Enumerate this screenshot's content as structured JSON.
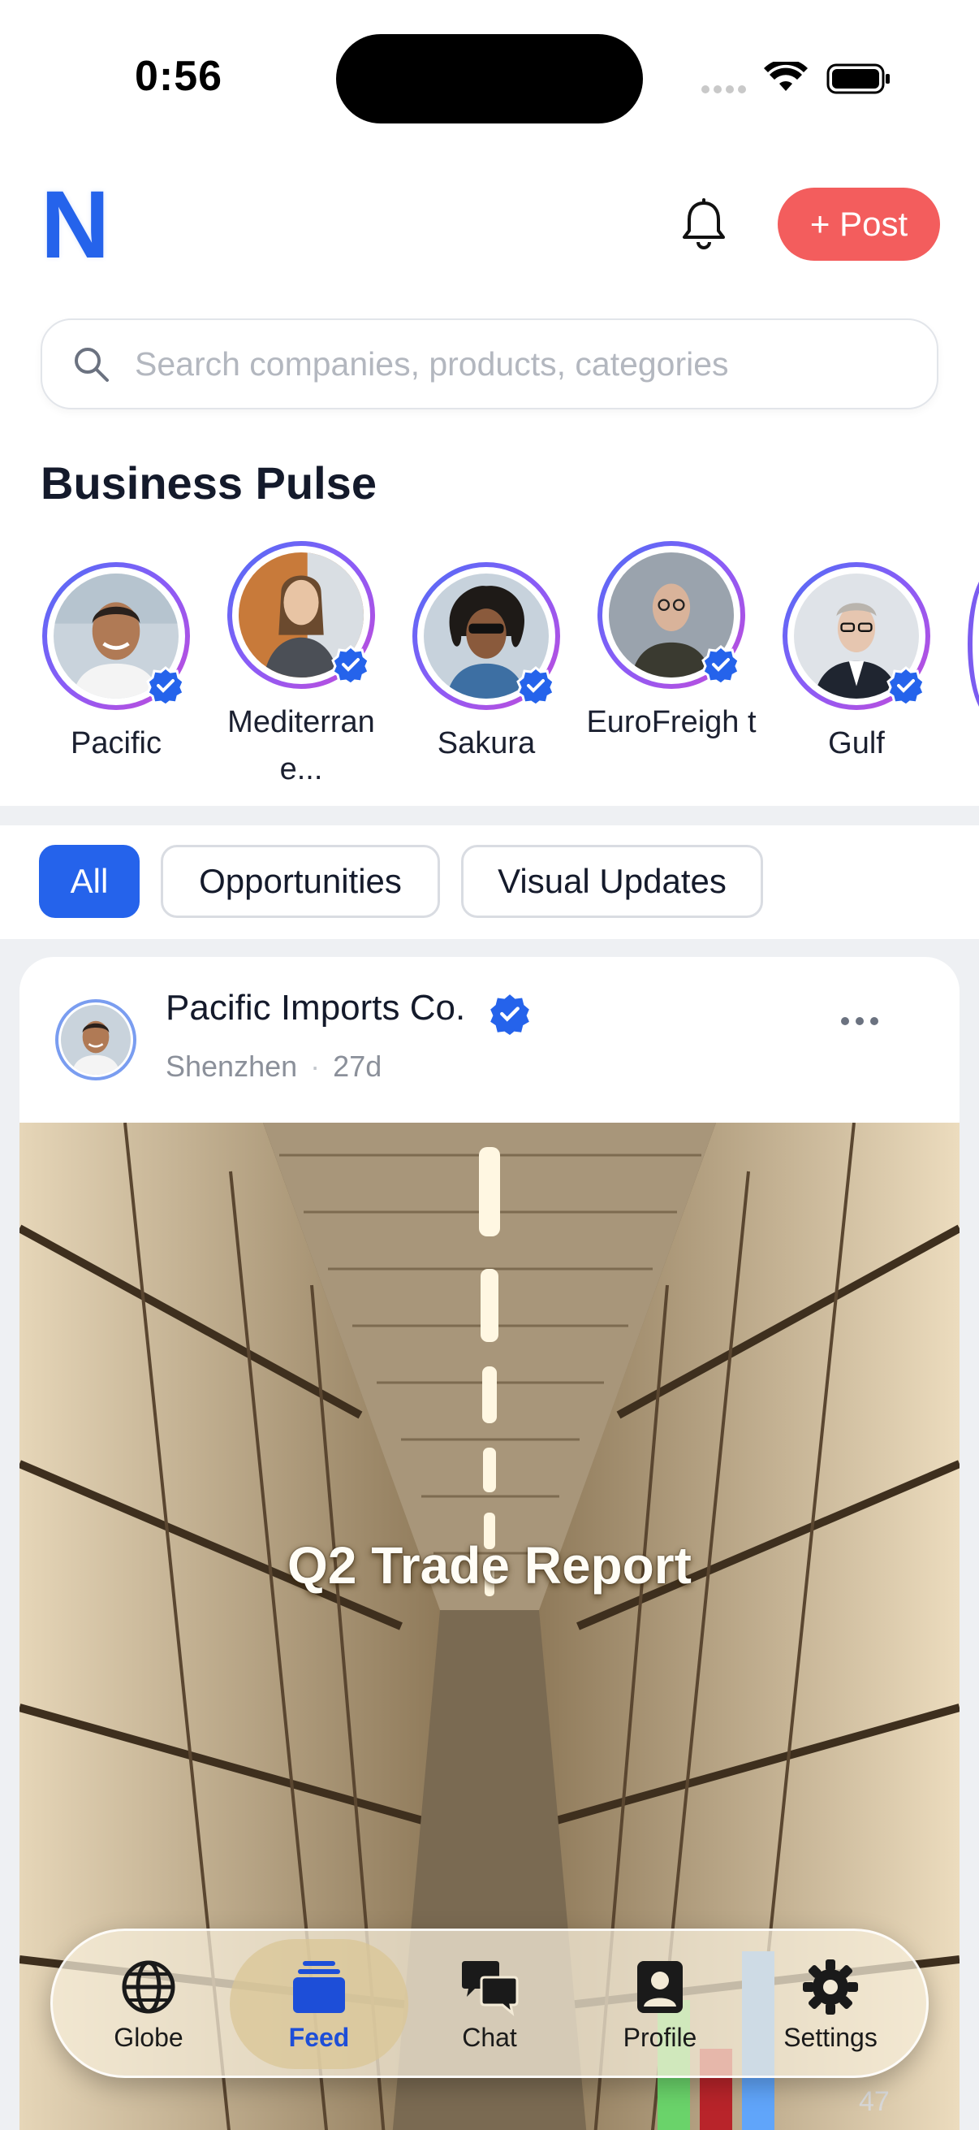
{
  "status_bar": {
    "time": "0:56"
  },
  "header": {
    "logo_letter": "N",
    "post_button": "+ Post"
  },
  "search": {
    "placeholder": "Search companies, products, categories"
  },
  "business_pulse": {
    "title": "Business Pulse",
    "stories": [
      {
        "name": "Pacific"
      },
      {
        "name": "Mediterran e..."
      },
      {
        "name": "Sakura"
      },
      {
        "name": "EuroFreigh t"
      },
      {
        "name": "Gulf"
      }
    ]
  },
  "filters": [
    "All",
    "Opportunities",
    "Visual Updates"
  ],
  "post": {
    "company": "Pacific Imports Co.",
    "location": "Shenzhen",
    "separator": "·",
    "age": "27d",
    "media_title": "Q2 Trade Report",
    "counter": "47"
  },
  "tabs": [
    "Globe",
    "Feed",
    "Chat",
    "Profile",
    "Settings"
  ],
  "colors": {
    "brand": "#2563eb",
    "post_button": "#f35d5d",
    "active_tab": "#1d4ed8"
  }
}
